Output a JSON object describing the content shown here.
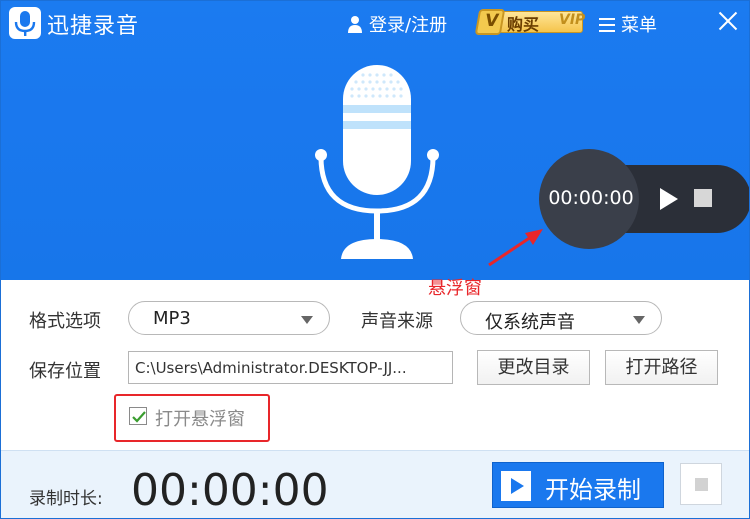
{
  "app": {
    "name": "迅捷录音"
  },
  "header": {
    "login_label": "登录/注册",
    "vip_buy_label": "购买",
    "vip_badge": "V",
    "vip_tag": "VIP",
    "menu_label": "菜单"
  },
  "floating_window": {
    "time": "00:00:00",
    "annotation_label": "悬浮窗"
  },
  "settings": {
    "format_label": "格式选项",
    "format_value": "MP3",
    "source_label": "声音来源",
    "source_value": "仅系统声音",
    "save_label": "保存位置",
    "save_path": "C:\\Users\\Administrator.DESKTOP-JJ...",
    "change_dir_label": "更改目录",
    "open_path_label": "打开路径",
    "float_checkbox_label": "打开悬浮窗",
    "float_checkbox_checked": true
  },
  "footer": {
    "duration_label": "录制时长:",
    "duration_value": "00:00:00",
    "start_label": "开始录制"
  },
  "colors": {
    "primary_blue": "#1a78ee",
    "annotation_red": "#e8262a",
    "bottom_bg": "#eaf3fc"
  }
}
